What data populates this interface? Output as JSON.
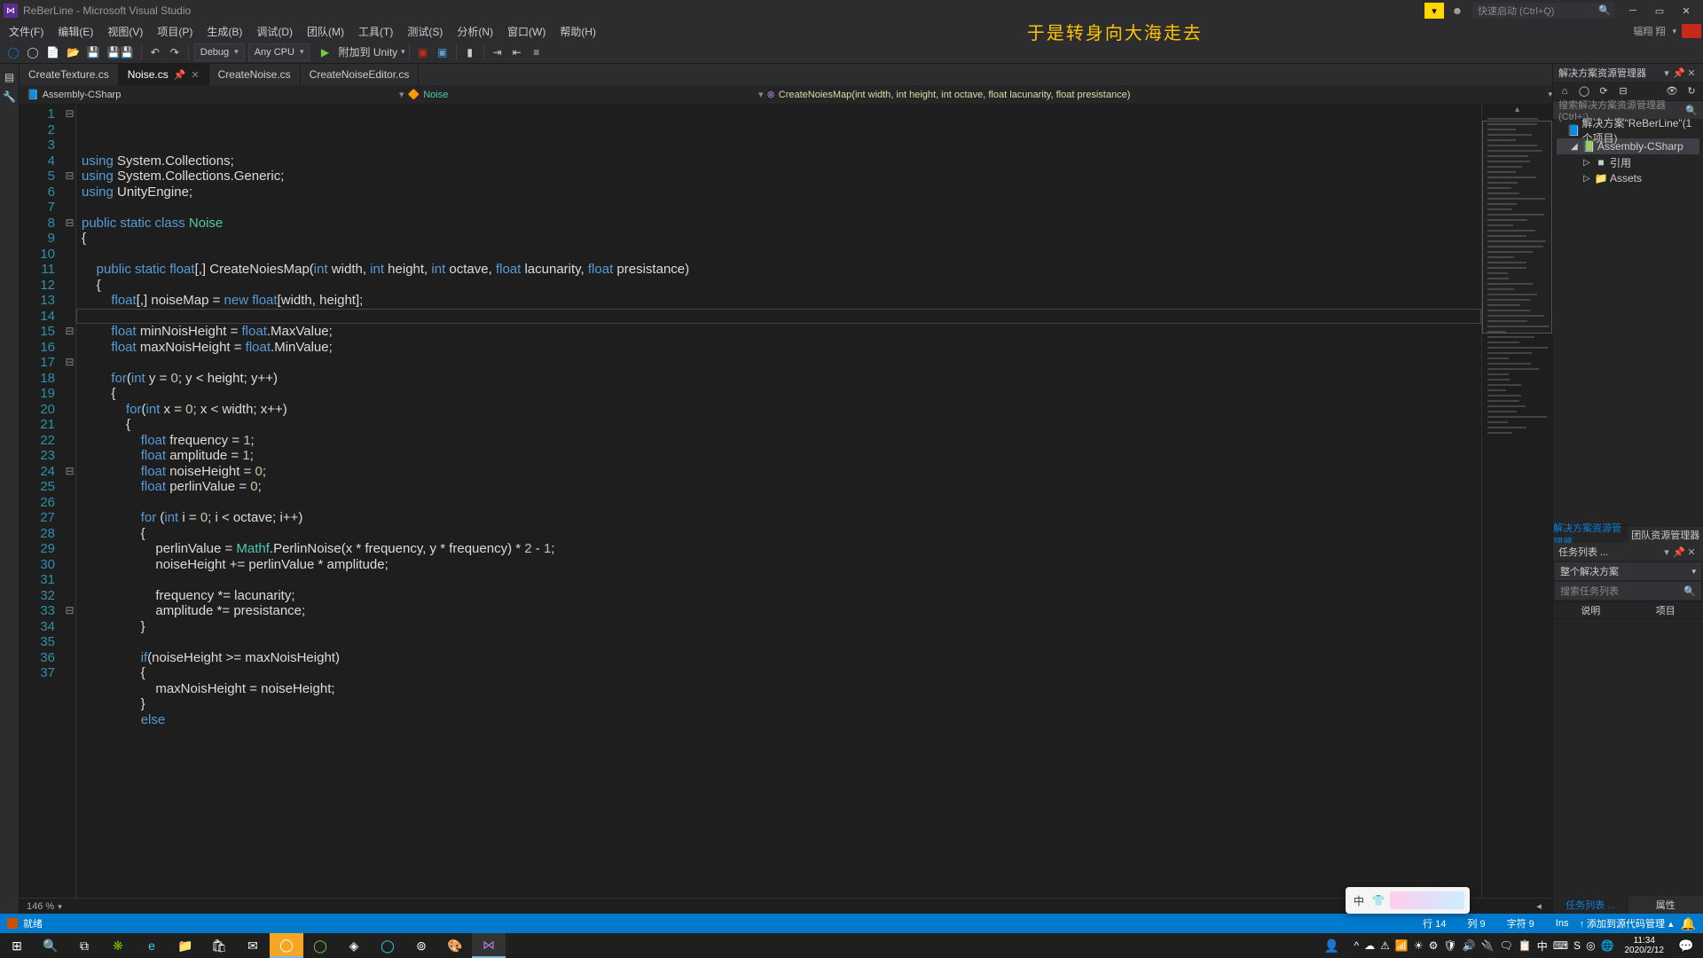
{
  "title": "ReBerLine - Microsoft Visual Studio",
  "quicklaunch_ph": "快速启动 (Ctrl+Q)",
  "user": "辐翔 翔",
  "menu": [
    "文件(F)",
    "编辑(E)",
    "视图(V)",
    "项目(P)",
    "生成(B)",
    "调试(D)",
    "团队(M)",
    "工具(T)",
    "测试(S)",
    "分析(N)",
    "窗口(W)",
    "帮助(H)"
  ],
  "caption": "于是转身向大海走去",
  "config": "Debug",
  "platform": "Any CPU",
  "debug_target": "附加到 Unity",
  "tabs": [
    {
      "label": "CreateTexture.cs",
      "active": false
    },
    {
      "label": "Noise.cs",
      "active": true
    },
    {
      "label": "CreateNoise.cs",
      "active": false
    },
    {
      "label": "CreateNoiseEditor.cs",
      "active": false
    }
  ],
  "nav_project": "Assembly-CSharp",
  "nav_class": "Noise",
  "nav_method": "CreateNoiesMap(int width, int height, int octave, float lacunarity, float presistance)",
  "zoom": "146 %",
  "lines": [
    [
      [
        "kw",
        "using"
      ],
      [
        "",
        " System.Collections;"
      ]
    ],
    [
      [
        "kw",
        "using"
      ],
      [
        "",
        " System.Collections.Generic;"
      ]
    ],
    [
      [
        "kw",
        "using"
      ],
      [
        "",
        " UnityEngine;"
      ]
    ],
    [
      [
        "",
        ""
      ]
    ],
    [
      [
        "kw",
        "public static class"
      ],
      [
        "",
        " "
      ],
      [
        "cls",
        "Noise"
      ]
    ],
    [
      [
        "",
        "{"
      ]
    ],
    [
      [
        "",
        ""
      ]
    ],
    [
      [
        "",
        "    "
      ],
      [
        "kw",
        "public static"
      ],
      [
        "",
        " "
      ],
      [
        "type",
        "float"
      ],
      [
        "",
        "[,] CreateNoiesMap("
      ],
      [
        "type",
        "int"
      ],
      [
        "",
        " width, "
      ],
      [
        "type",
        "int"
      ],
      [
        "",
        " height, "
      ],
      [
        "type",
        "int"
      ],
      [
        "",
        " octave, "
      ],
      [
        "type",
        "float"
      ],
      [
        "",
        " lacunarity, "
      ],
      [
        "type",
        "float"
      ],
      [
        "",
        " presistance)"
      ]
    ],
    [
      [
        "",
        "    {"
      ]
    ],
    [
      [
        "",
        "        "
      ],
      [
        "type",
        "float"
      ],
      [
        "",
        "[,] noiseMap = "
      ],
      [
        "kw",
        "new"
      ],
      [
        "",
        " "
      ],
      [
        "type",
        "float"
      ],
      [
        "",
        "[width, height];"
      ]
    ],
    [
      [
        "",
        ""
      ]
    ],
    [
      [
        "",
        "        "
      ],
      [
        "type",
        "float"
      ],
      [
        "",
        " minNoisHeight = "
      ],
      [
        "type",
        "float"
      ],
      [
        "",
        ".MaxValue;"
      ]
    ],
    [
      [
        "",
        "        "
      ],
      [
        "type",
        "float"
      ],
      [
        "",
        " maxNoisHeight = "
      ],
      [
        "type",
        "float"
      ],
      [
        "",
        ".MinValue;"
      ]
    ],
    [
      [
        "",
        ""
      ]
    ],
    [
      [
        "",
        "        "
      ],
      [
        "kw",
        "for"
      ],
      [
        "",
        "("
      ],
      [
        "type",
        "int"
      ],
      [
        "",
        " y = "
      ],
      [
        "num",
        "0"
      ],
      [
        "",
        "; y < height; y++)"
      ]
    ],
    [
      [
        "",
        "        {"
      ]
    ],
    [
      [
        "",
        "            "
      ],
      [
        "kw",
        "for"
      ],
      [
        "",
        "("
      ],
      [
        "type",
        "int"
      ],
      [
        "",
        " x = "
      ],
      [
        "num",
        "0"
      ],
      [
        "",
        "; x < width; x++)"
      ]
    ],
    [
      [
        "",
        "            {"
      ]
    ],
    [
      [
        "",
        "                "
      ],
      [
        "type",
        "float"
      ],
      [
        "",
        " frequency = "
      ],
      [
        "num",
        "1"
      ],
      [
        "",
        ";"
      ]
    ],
    [
      [
        "",
        "                "
      ],
      [
        "type",
        "float"
      ],
      [
        "",
        " amplitude = "
      ],
      [
        "num",
        "1"
      ],
      [
        "",
        ";"
      ]
    ],
    [
      [
        "",
        "                "
      ],
      [
        "type",
        "float"
      ],
      [
        "",
        " noiseHeight = "
      ],
      [
        "num",
        "0"
      ],
      [
        "",
        ";"
      ]
    ],
    [
      [
        "",
        "                "
      ],
      [
        "type",
        "float"
      ],
      [
        "",
        " perlinValue = "
      ],
      [
        "num",
        "0"
      ],
      [
        "",
        ";"
      ]
    ],
    [
      [
        "",
        ""
      ]
    ],
    [
      [
        "",
        "                "
      ],
      [
        "kw",
        "for"
      ],
      [
        "",
        " ("
      ],
      [
        "type",
        "int"
      ],
      [
        "",
        " i = "
      ],
      [
        "num",
        "0"
      ],
      [
        "",
        "; i < octave; i++)"
      ]
    ],
    [
      [
        "",
        "                {"
      ]
    ],
    [
      [
        "",
        "                    perlinValue = "
      ],
      [
        "cls",
        "Mathf"
      ],
      [
        "",
        ".PerlinNoise(x * frequency, y * frequency) * "
      ],
      [
        "num",
        "2"
      ],
      [
        "",
        " - "
      ],
      [
        "num",
        "1"
      ],
      [
        "",
        ";"
      ]
    ],
    [
      [
        "",
        "                    noiseHeight += perlinValue * amplitude;"
      ]
    ],
    [
      [
        "",
        ""
      ]
    ],
    [
      [
        "",
        "                    frequency *= lacunarity;"
      ]
    ],
    [
      [
        "",
        "                    amplitude *= presistance;"
      ]
    ],
    [
      [
        "",
        "                }"
      ]
    ],
    [
      [
        "",
        ""
      ]
    ],
    [
      [
        "",
        "                "
      ],
      [
        "kw",
        "if"
      ],
      [
        "",
        "(noiseHeight >= maxNoisHeight)"
      ]
    ],
    [
      [
        "",
        "                {"
      ]
    ],
    [
      [
        "",
        "                    maxNoisHeight = noiseHeight;"
      ]
    ],
    [
      [
        "",
        "                }"
      ]
    ],
    [
      [
        "",
        "                "
      ],
      [
        "kw",
        "else"
      ]
    ]
  ],
  "fold": {
    "1": "⊟",
    "5": "⊟",
    "8": "⊟",
    "15": "⊟",
    "17": "⊟",
    "24": "⊟",
    "33": "⊟"
  },
  "highlight_line": 14,
  "sln_hdr": "解决方案资源管理器",
  "sln_search_ph": "搜索解决方案资源管理器(Ctrl+;)",
  "sln_tree": [
    {
      "indent": 0,
      "tw": "",
      "icon": "📘",
      "label": "解决方案\"ReBerLine\"(1 个项目)",
      "sel": false
    },
    {
      "indent": 1,
      "tw": "◢",
      "icon": "📗",
      "label": "Assembly-CSharp",
      "sel": true
    },
    {
      "indent": 2,
      "tw": "▷",
      "icon": "■",
      "label": "引用",
      "sel": false
    },
    {
      "indent": 2,
      "tw": "▷",
      "icon": "📁",
      "label": "Assets",
      "sel": false
    }
  ],
  "panel_tab1": "解决方案资源管理器",
  "panel_tab2": "团队资源管理器",
  "task_hdr": "任务列表 ...",
  "task_scope": "整个解决方案",
  "task_search_ph": "搜索任务列表",
  "task_col1": "说明",
  "task_col2": "项目",
  "ptab_task": "任务列表 ...",
  "ptab_prop": "属性",
  "status_ready": "就绪",
  "status_line": "行 14",
  "status_col": "列 9",
  "status_char": "字符 9",
  "status_ins": "Ins",
  "status_src": "↑ 添加到源代码管理",
  "time": "11:34",
  "date": "2020/2/12",
  "ime": [
    "中",
    "👕"
  ],
  "tray": [
    "^",
    "☁",
    "⚠",
    "📶",
    "☀",
    "⚙",
    "🛡",
    "🔊",
    "🔌",
    "🗨",
    "📋",
    "中",
    "⌨",
    "S",
    "◎",
    "🌐"
  ]
}
